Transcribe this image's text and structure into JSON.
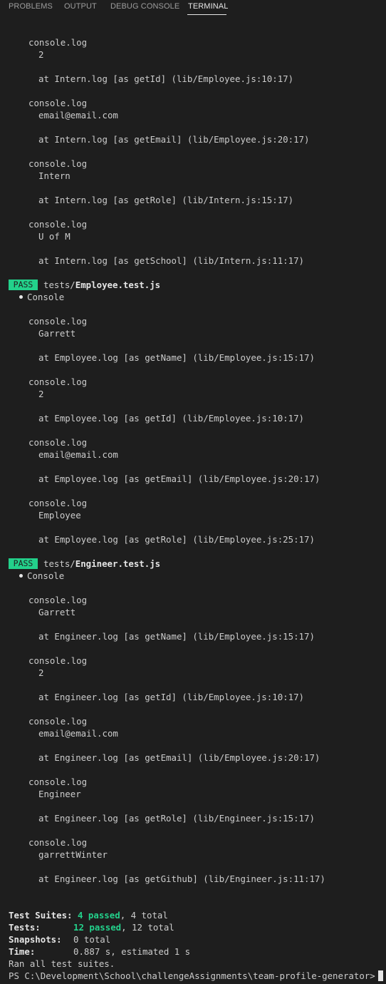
{
  "tabs": [
    {
      "label": "PROBLEMS",
      "active": false
    },
    {
      "label": "OUTPUT",
      "active": false
    },
    {
      "label": "DEBUG CONSOLE",
      "active": false
    },
    {
      "label": "TERMINAL",
      "active": true
    }
  ],
  "terminal": {
    "intern_tail": [
      {
        "head": "console.log",
        "value": "2",
        "at": "at Intern.log [as getId] (lib/Employee.js:10:17)"
      },
      {
        "head": "console.log",
        "value": "email@email.com",
        "at": "at Intern.log [as getEmail] (lib/Employee.js:20:17)"
      },
      {
        "head": "console.log",
        "value": "Intern",
        "at": "at Intern.log [as getRole] (lib/Intern.js:15:17)"
      },
      {
        "head": "console.log",
        "value": "U of M",
        "at": "at Intern.log [as getSchool] (lib/Intern.js:11:17)"
      }
    ],
    "suites": [
      {
        "badge": "PASS",
        "path_dir": "tests/",
        "path_file": "Employee.test.js",
        "console_label": "Console",
        "logs": [
          {
            "head": "console.log",
            "value": "Garrett",
            "at": "at Employee.log [as getName] (lib/Employee.js:15:17)"
          },
          {
            "head": "console.log",
            "value": "2",
            "at": "at Employee.log [as getId] (lib/Employee.js:10:17)"
          },
          {
            "head": "console.log",
            "value": "email@email.com",
            "at": "at Employee.log [as getEmail] (lib/Employee.js:20:17)"
          },
          {
            "head": "console.log",
            "value": "Employee",
            "at": "at Employee.log [as getRole] (lib/Employee.js:25:17)"
          }
        ]
      },
      {
        "badge": "PASS",
        "path_dir": "tests/",
        "path_file": "Engineer.test.js",
        "console_label": "Console",
        "logs": [
          {
            "head": "console.log",
            "value": "Garrett",
            "at": "at Engineer.log [as getName] (lib/Employee.js:15:17)"
          },
          {
            "head": "console.log",
            "value": "2",
            "at": "at Engineer.log [as getId] (lib/Employee.js:10:17)"
          },
          {
            "head": "console.log",
            "value": "email@email.com",
            "at": "at Engineer.log [as getEmail] (lib/Employee.js:20:17)"
          },
          {
            "head": "console.log",
            "value": "Engineer",
            "at": "at Engineer.log [as getRole] (lib/Engineer.js:15:17)"
          },
          {
            "head": "console.log",
            "value": "garrettWinter",
            "at": "at Engineer.log [as getGithub] (lib/Engineer.js:11:17)"
          }
        ]
      }
    ],
    "summary": {
      "suites_label": "Test Suites:",
      "suites_passed": "4 passed",
      "suites_total": ", 4 total",
      "tests_label": "Tests:",
      "tests_passed": "12 passed",
      "tests_total": ", 12 total",
      "snapshots_label": "Snapshots:",
      "snapshots_value": "0 total",
      "time_label": "Time:",
      "time_value": "0.887 s, estimated 1 s",
      "ran_all": "Ran all test suites."
    },
    "prompt": "PS C:\\Development\\School\\challengeAssignments\\team-profile-generator>"
  },
  "colors": {
    "background": "#1e1e1e",
    "text": "#cccccc",
    "pass_badge": "#23d18b",
    "passed_text": "#23d18b",
    "active_tab": "#e7e7e7",
    "inactive_tab": "#9d9d9d"
  }
}
